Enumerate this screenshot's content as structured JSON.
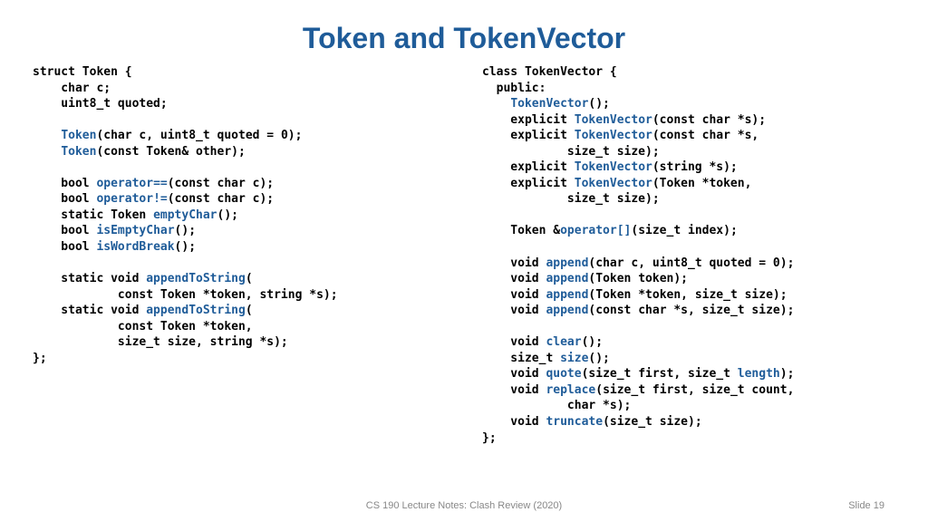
{
  "title": "Token and TokenVector",
  "left_code": [
    {
      "t": "plain",
      "v": "struct Token {"
    },
    {
      "t": "plain",
      "v": "    char c;"
    },
    {
      "t": "plain",
      "v": "    uint8_t quoted;"
    },
    {
      "t": "plain",
      "v": ""
    },
    {
      "t": "mix",
      "pre": "    ",
      "kw": "Token",
      "post": "(char c, uint8_t quoted = 0);"
    },
    {
      "t": "mix",
      "pre": "    ",
      "kw": "Token",
      "post": "(const Token& other);"
    },
    {
      "t": "plain",
      "v": ""
    },
    {
      "t": "mix",
      "pre": "    bool ",
      "kw": "operator==",
      "post": "(const char c);"
    },
    {
      "t": "mix",
      "pre": "    bool ",
      "kw": "operator!=",
      "post": "(const char c);"
    },
    {
      "t": "mix",
      "pre": "    static Token ",
      "kw": "emptyChar",
      "post": "();"
    },
    {
      "t": "mix",
      "pre": "    bool ",
      "kw": "isEmptyChar",
      "post": "();"
    },
    {
      "t": "mix",
      "pre": "    bool ",
      "kw": "isWordBreak",
      "post": "();"
    },
    {
      "t": "plain",
      "v": ""
    },
    {
      "t": "mix",
      "pre": "    static void ",
      "kw": "appendToString",
      "post": "("
    },
    {
      "t": "plain",
      "v": "            const Token *token, string *s);"
    },
    {
      "t": "mix",
      "pre": "    static void ",
      "kw": "appendToString",
      "post": "("
    },
    {
      "t": "plain",
      "v": "            const Token *token,"
    },
    {
      "t": "plain",
      "v": "            size_t size, string *s);"
    },
    {
      "t": "plain",
      "v": "};"
    }
  ],
  "right_code": [
    {
      "t": "plain",
      "v": "class TokenVector {"
    },
    {
      "t": "plain",
      "v": "  public:"
    },
    {
      "t": "mix",
      "pre": "    ",
      "kw": "TokenVector",
      "post": "();"
    },
    {
      "t": "mix",
      "pre": "    explicit ",
      "kw": "TokenVector",
      "post": "(const char *s);"
    },
    {
      "t": "mix",
      "pre": "    explicit ",
      "kw": "TokenVector",
      "post": "(const char *s,"
    },
    {
      "t": "plain",
      "v": "            size_t size);"
    },
    {
      "t": "mix",
      "pre": "    explicit ",
      "kw": "TokenVector",
      "post": "(string *s);"
    },
    {
      "t": "mix",
      "pre": "    explicit ",
      "kw": "TokenVector",
      "post": "(Token *token,"
    },
    {
      "t": "plain",
      "v": "            size_t size);"
    },
    {
      "t": "plain",
      "v": ""
    },
    {
      "t": "mix",
      "pre": "    Token &",
      "kw": "operator[]",
      "post": "(size_t index);"
    },
    {
      "t": "plain",
      "v": ""
    },
    {
      "t": "mix",
      "pre": "    void ",
      "kw": "append",
      "post": "(char c, uint8_t quoted = 0);"
    },
    {
      "t": "mix",
      "pre": "    void ",
      "kw": "append",
      "post": "(Token token);"
    },
    {
      "t": "mix",
      "pre": "    void ",
      "kw": "append",
      "post": "(Token *token, size_t size);"
    },
    {
      "t": "mix",
      "pre": "    void ",
      "kw": "append",
      "post": "(const char *s, size_t size);"
    },
    {
      "t": "plain",
      "v": ""
    },
    {
      "t": "mix",
      "pre": "    void ",
      "kw": "clear",
      "post": "();"
    },
    {
      "t": "mix",
      "pre": "    size_t ",
      "kw": "size",
      "post": "();"
    },
    {
      "t": "mix2",
      "pre": "    void ",
      "kw": "quote",
      "post": "(size_t first, size_t ",
      "kw2": "length",
      "post2": ");"
    },
    {
      "t": "mix",
      "pre": "    void ",
      "kw": "replace",
      "post": "(size_t first, size_t count,"
    },
    {
      "t": "plain",
      "v": "            char *s);"
    },
    {
      "t": "mix",
      "pre": "    void ",
      "kw": "truncate",
      "post": "(size_t size);"
    },
    {
      "t": "plain",
      "v": "};"
    }
  ],
  "footer": {
    "center": "CS 190 Lecture Notes: Clash Review (2020)",
    "right": "Slide 19"
  }
}
